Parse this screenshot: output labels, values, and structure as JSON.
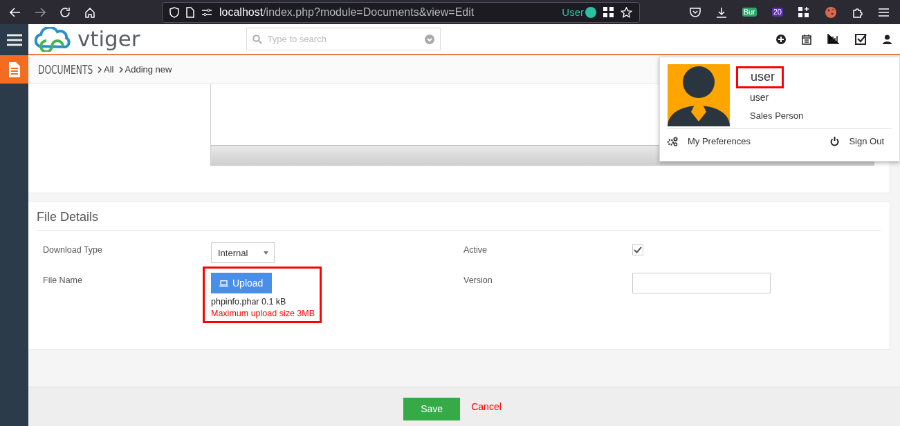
{
  "browser": {
    "url": {
      "host": "localhost",
      "path": "/index.php?module=Documents&view=Edit"
    },
    "container_label": "User",
    "extension_badges": [
      {
        "text": "Bur",
        "color": "#2ea86a"
      },
      {
        "text": "20",
        "color": "#5b2db0"
      }
    ]
  },
  "header": {
    "logo_text": "vtiger",
    "search": {
      "placeholder": "Type to search"
    }
  },
  "breadcrumb": [
    "DOCUMENTS",
    "All",
    "Adding new"
  ],
  "user_menu": {
    "name": "user",
    "name_highlighted": true,
    "username": "user",
    "role": "Sales Person",
    "actions": [
      {
        "kind": "preferences",
        "label": "My Preferences"
      },
      {
        "kind": "signout",
        "label": "Sign Out"
      }
    ]
  },
  "file_details": {
    "title": "File Details",
    "fields": [
      {
        "kind": "select",
        "label": "Download Type",
        "value": "Internal"
      },
      {
        "kind": "checkbox",
        "label": "Active",
        "checked": true
      },
      {
        "kind": "upload",
        "label": "File Name",
        "button": "Upload",
        "file": "phpinfo.phar 0.1 kB",
        "note": "Maximum upload size 3MB",
        "highlighted": true
      },
      {
        "kind": "text",
        "label": "Version"
      }
    ]
  },
  "footer": {
    "save": "Save",
    "cancel": "Cancel"
  }
}
